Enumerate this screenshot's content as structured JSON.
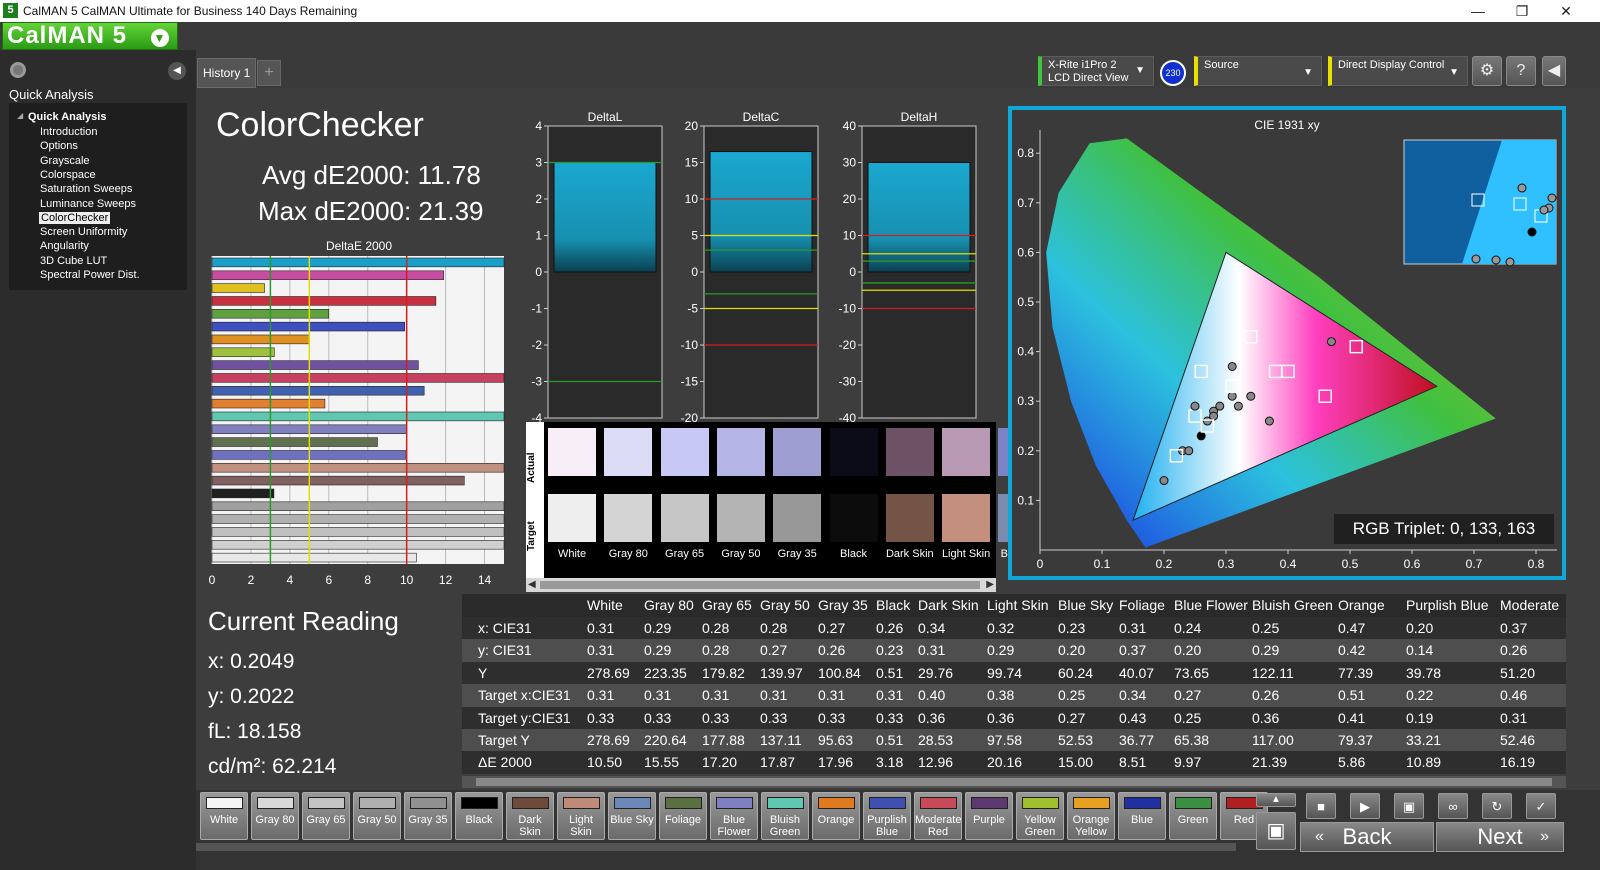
{
  "window": {
    "app_icon": "5",
    "title": "CalMAN 5 CalMAN Ultimate for Business 140 Days Remaining"
  },
  "logo": {
    "text": "CalMAN 5"
  },
  "sidebar": {
    "heading": "Quick Analysis",
    "tree_root": "Quick Analysis",
    "items": [
      "Introduction",
      "Options",
      "Grayscale",
      "Colorspace",
      "Saturation Sweeps",
      "Luminance Sweeps",
      "ColorChecker",
      "Screen Uniformity",
      "Angularity",
      "3D Cube LUT",
      "Spectral Power Dist."
    ],
    "selected": "ColorChecker"
  },
  "history": {
    "tab": "History 1",
    "add": "+"
  },
  "devices": {
    "meter_line1": "X-Rite i1Pro 2",
    "meter_line2": "LCD Direct View",
    "meter_badge": "230",
    "source": "Source",
    "display": "Direct Display Control",
    "meter_color": "#3ec63e",
    "source_color": "#e8e000",
    "display_color": "#e8e000"
  },
  "colorchecker": {
    "title": "ColorChecker",
    "avg": "Avg dE2000: 11.78",
    "max": "Max dE2000: 21.39"
  },
  "deltae_chart": {
    "title": "DeltaE 2000",
    "ticks": [
      "0",
      "2",
      "4",
      "6",
      "8",
      "10",
      "12",
      "14"
    ],
    "xlim": [
      0,
      15
    ],
    "thresholds": [
      {
        "value": 3,
        "color": "#2a9a2a"
      },
      {
        "value": 5,
        "color": "#e0e000"
      },
      {
        "value": 10,
        "color": "#d02020"
      }
    ],
    "bars": [
      {
        "value": 15,
        "color": "#1aa0c8"
      },
      {
        "value": 11.9,
        "color": "#c84ca0"
      },
      {
        "value": 2.7,
        "color": "#e0c020"
      },
      {
        "value": 11.5,
        "color": "#c83040"
      },
      {
        "value": 6,
        "color": "#60a040"
      },
      {
        "value": 9.9,
        "color": "#4050c0"
      },
      {
        "value": 5,
        "color": "#e09020"
      },
      {
        "value": 3.2,
        "color": "#a0c040"
      },
      {
        "value": 10.6,
        "color": "#7050a0"
      },
      {
        "value": 15,
        "color": "#c84060"
      },
      {
        "value": 10.9,
        "color": "#4060b0"
      },
      {
        "value": 5.8,
        "color": "#e08030"
      },
      {
        "value": 15,
        "color": "#60c8b0"
      },
      {
        "value": 10,
        "color": "#8080c0"
      },
      {
        "value": 8.5,
        "color": "#607050"
      },
      {
        "value": 9.97,
        "color": "#7070c0"
      },
      {
        "value": 15,
        "color": "#c09080"
      },
      {
        "value": 12.96,
        "color": "#806060"
      },
      {
        "value": 3.18,
        "color": "#202020"
      },
      {
        "value": 15,
        "color": "#a0a0a0"
      },
      {
        "value": 15,
        "color": "#b0b0b0"
      },
      {
        "value": 15,
        "color": "#c0c0c0"
      },
      {
        "value": 15,
        "color": "#d0d0d0"
      },
      {
        "value": 10.5,
        "color": "#e8e8e8"
      }
    ]
  },
  "delta_charts": [
    {
      "title": "DeltaL",
      "ticks": [
        "4",
        "3",
        "2",
        "1",
        "0",
        "-1",
        "-2",
        "-3",
        "-4"
      ],
      "ylim": [
        -4,
        4
      ],
      "bar_top": 3,
      "lines": [
        {
          "value": 3,
          "color": "#2a9a2a"
        },
        {
          "value": -3,
          "color": "#2a9a2a"
        }
      ]
    },
    {
      "title": "DeltaC",
      "ticks": [
        "20",
        "15",
        "10",
        "5",
        "0",
        "-5",
        "-10",
        "-15",
        "-20"
      ],
      "ylim": [
        -20,
        20
      ],
      "bar_top": 16.5,
      "lines": [
        {
          "value": 10,
          "color": "#d02020"
        },
        {
          "value": 5,
          "color": "#e0e000"
        },
        {
          "value": 3,
          "color": "#2a9a2a"
        },
        {
          "value": -3,
          "color": "#2a9a2a"
        },
        {
          "value": -5,
          "color": "#e0e000"
        },
        {
          "value": -10,
          "color": "#d02020"
        }
      ]
    },
    {
      "title": "DeltaH",
      "ticks": [
        "40",
        "30",
        "20",
        "10",
        "0",
        "-10",
        "-20",
        "-30",
        "-40"
      ],
      "ylim": [
        -40,
        40
      ],
      "bar_top": 30,
      "lines": [
        {
          "value": 10,
          "color": "#d02020"
        },
        {
          "value": 5,
          "color": "#e0e000"
        },
        {
          "value": 3,
          "color": "#2a9a2a"
        },
        {
          "value": -3,
          "color": "#2a9a2a"
        },
        {
          "value": -5,
          "color": "#e0e000"
        },
        {
          "value": -10,
          "color": "#d02020"
        }
      ]
    }
  ],
  "swatches": {
    "actual_label": "Actual",
    "target_label": "Target",
    "items": [
      {
        "name": "White",
        "actual": "#f8eef8",
        "target": "#eeeeee"
      },
      {
        "name": "Gray 80",
        "actual": "#dcdcf6",
        "target": "#d4d4d4"
      },
      {
        "name": "Gray 65",
        "actual": "#c8c8f4",
        "target": "#c6c6c6"
      },
      {
        "name": "Gray 50",
        "actual": "#b4b4e6",
        "target": "#b4b4b4"
      },
      {
        "name": "Gray 35",
        "actual": "#9e9ed2",
        "target": "#989898"
      },
      {
        "name": "Black",
        "actual": "#0c0c18",
        "target": "#0c0c0c"
      },
      {
        "name": "Dark Skin",
        "actual": "#6c5264",
        "target": "#735446"
      },
      {
        "name": "Light Skin",
        "actual": "#b89ab4",
        "target": "#c4907e"
      },
      {
        "name": "Blue Sky",
        "actual": "#7c84c8",
        "target": "#7c8cb0"
      }
    ]
  },
  "cie": {
    "title": "CIE 1931 xy",
    "rgb_triplet": "RGB Triplet: 0, 133, 163",
    "xticks": [
      "0",
      "0.1",
      "0.2",
      "0.3",
      "0.4",
      "0.5",
      "0.6",
      "0.7",
      "0.8"
    ],
    "yticks": [
      "0.1",
      "0.2",
      "0.3",
      "0.4",
      "0.5",
      "0.6",
      "0.7",
      "0.8"
    ]
  },
  "reading": {
    "title": "Current Reading",
    "x": "x: 0.2049",
    "y": "y: 0.2022",
    "fl": "fL: 18.158",
    "cdm2": "cd/m²: 62.214"
  },
  "table": {
    "headers": [
      "White",
      "Gray 80",
      "Gray 65",
      "Gray 50",
      "Gray 35",
      "Black",
      "Dark Skin",
      "Light Skin",
      "Blue Sky",
      "Foliage",
      "Blue Flower",
      "Bluish Green",
      "Orange",
      "Purplish Blue",
      "Moderate"
    ],
    "rows": [
      {
        "label": "x: CIE31",
        "values": [
          "0.31",
          "0.29",
          "0.28",
          "0.28",
          "0.27",
          "0.26",
          "0.34",
          "0.32",
          "0.23",
          "0.31",
          "0.24",
          "0.25",
          "0.47",
          "0.20",
          "0.37"
        ]
      },
      {
        "label": "y: CIE31",
        "values": [
          "0.31",
          "0.29",
          "0.28",
          "0.27",
          "0.26",
          "0.23",
          "0.31",
          "0.29",
          "0.20",
          "0.37",
          "0.20",
          "0.29",
          "0.42",
          "0.14",
          "0.26"
        ]
      },
      {
        "label": "Y",
        "values": [
          "278.69",
          "223.35",
          "179.82",
          "139.97",
          "100.84",
          "0.51",
          "29.76",
          "99.74",
          "60.24",
          "40.07",
          "73.65",
          "122.11",
          "77.39",
          "39.78",
          "51.20"
        ]
      },
      {
        "label": "Target x:CIE31",
        "values": [
          "0.31",
          "0.31",
          "0.31",
          "0.31",
          "0.31",
          "0.31",
          "0.40",
          "0.38",
          "0.25",
          "0.34",
          "0.27",
          "0.26",
          "0.51",
          "0.22",
          "0.46"
        ]
      },
      {
        "label": "Target y:CIE31",
        "values": [
          "0.33",
          "0.33",
          "0.33",
          "0.33",
          "0.33",
          "0.33",
          "0.36",
          "0.36",
          "0.27",
          "0.43",
          "0.25",
          "0.36",
          "0.41",
          "0.19",
          "0.31"
        ]
      },
      {
        "label": "Target Y",
        "values": [
          "278.69",
          "220.64",
          "177.88",
          "137.11",
          "95.63",
          "0.51",
          "28.53",
          "97.58",
          "52.53",
          "36.77",
          "65.38",
          "117.00",
          "79.37",
          "33.21",
          "52.46"
        ]
      },
      {
        "label": "ΔE 2000",
        "values": [
          "10.50",
          "15.55",
          "17.20",
          "17.87",
          "17.96",
          "3.18",
          "12.96",
          "20.16",
          "15.00",
          "8.51",
          "9.97",
          "21.39",
          "5.86",
          "10.89",
          "16.19"
        ]
      }
    ]
  },
  "patch_buttons": [
    {
      "label": "White",
      "color": "#f4f4f4"
    },
    {
      "label": "Gray 80",
      "color": "#d8d8d8"
    },
    {
      "label": "Gray 65",
      "color": "#c4c4c4"
    },
    {
      "label": "Gray 50",
      "color": "#b0b0b0"
    },
    {
      "label": "Gray 35",
      "color": "#909090"
    },
    {
      "label": "Black",
      "color": "#000000"
    },
    {
      "label": "Dark Skin",
      "color": "#6e4a3c"
    },
    {
      "label": "Light Skin",
      "color": "#c08a78"
    },
    {
      "label": "Blue Sky",
      "color": "#6c88b8"
    },
    {
      "label": "Foliage",
      "color": "#5a7040"
    },
    {
      "label": "Blue Flower",
      "color": "#8080c0"
    },
    {
      "label": "Bluish Green",
      "color": "#60c8b0"
    },
    {
      "label": "Orange",
      "color": "#e07a20"
    },
    {
      "label": "Purplish Blue",
      "color": "#4050b0"
    },
    {
      "label": "Moderate Red",
      "color": "#c84a5a"
    },
    {
      "label": "Purple",
      "color": "#5c3a70"
    },
    {
      "label": "Yellow Green",
      "color": "#a0c030"
    },
    {
      "label": "Orange Yellow",
      "color": "#e8a020"
    },
    {
      "label": "Blue",
      "color": "#2030a0"
    },
    {
      "label": "Green",
      "color": "#3a9040"
    },
    {
      "label": "Red",
      "color": "#b02020"
    }
  ],
  "nav": {
    "back": "Back",
    "next": "Next"
  }
}
